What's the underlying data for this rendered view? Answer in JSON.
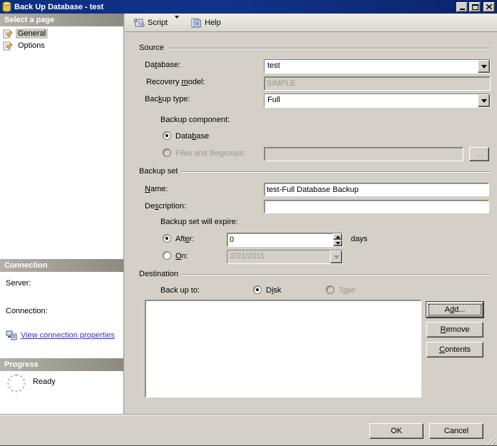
{
  "colors": {
    "titlebar_bg": "#0a246a",
    "dialog_bg": "#d4d0c8",
    "sidebar_bg": "#ffffff",
    "header_bar_gradient_from": "#b4b0a7",
    "header_bar_gradient_to": "#8d8a80",
    "selected_item_bg": "#cdc9c1",
    "link_color": "#3333cc",
    "disabled_text": "#9a9890"
  },
  "window": {
    "title": "Back Up Database - test"
  },
  "toolbar": {
    "script_label": "Script",
    "help_label": "Help"
  },
  "sidebar": {
    "select_page_header": "Select a page",
    "pages": [
      {
        "label": "General"
      },
      {
        "label": "Options"
      }
    ],
    "connection_header": "Connection",
    "server_label": "Server:",
    "connection_label": "Connection:",
    "view_connection_link": "View connection properties",
    "progress_header": "Progress",
    "progress_status": "Ready"
  },
  "source": {
    "group_label": "Source",
    "database_label": {
      "pre": "Da",
      "accel": "t",
      "post": "abase:"
    },
    "database_value": "test",
    "recovery_label": {
      "pre": "Recovery ",
      "accel": "m",
      "post": "odel:"
    },
    "recovery_value": "SIMPLE",
    "backup_type_label": {
      "pre": "Bac",
      "accel": "k",
      "post": "up type:"
    },
    "backup_type_value": "Full",
    "component_label": "Backup component:",
    "database_radio_label": {
      "pre": "Data",
      "accel": "b",
      "post": "ase"
    },
    "files_radio_label": "Files and filegroups:",
    "files_value": "",
    "browse_button_label": "..."
  },
  "backup_set": {
    "group_label": "Backup set",
    "name_label": {
      "pre": "",
      "accel": "N",
      "post": "ame:"
    },
    "name_value": "test-Full Database Backup",
    "description_label": {
      "pre": "De",
      "accel": "s",
      "post": "cription:"
    },
    "description_value": "",
    "expire_label": "Backup set will expire:",
    "after_label": {
      "pre": "Aft",
      "accel": "e",
      "post": "r:"
    },
    "after_value": "0",
    "days_label": "days",
    "on_label": {
      "pre": "",
      "accel": "O",
      "post": "n:"
    },
    "on_value": "2/21/2011"
  },
  "destination": {
    "group_label": "Destination",
    "backup_to_label": "Back up to:",
    "disk_label": {
      "pre": "D",
      "accel": "i",
      "post": "sk"
    },
    "tape_label": {
      "pre": "T",
      "accel": "a",
      "post": "pe"
    },
    "add_button": {
      "pre": "A",
      "accel": "d",
      "post": "d..."
    },
    "remove_button": {
      "pre": "",
      "accel": "R",
      "post": "emove"
    },
    "contents_button": {
      "pre": "",
      "accel": "C",
      "post": "ontents"
    }
  },
  "footer": {
    "ok_button": "OK",
    "cancel_button": "Cancel"
  }
}
